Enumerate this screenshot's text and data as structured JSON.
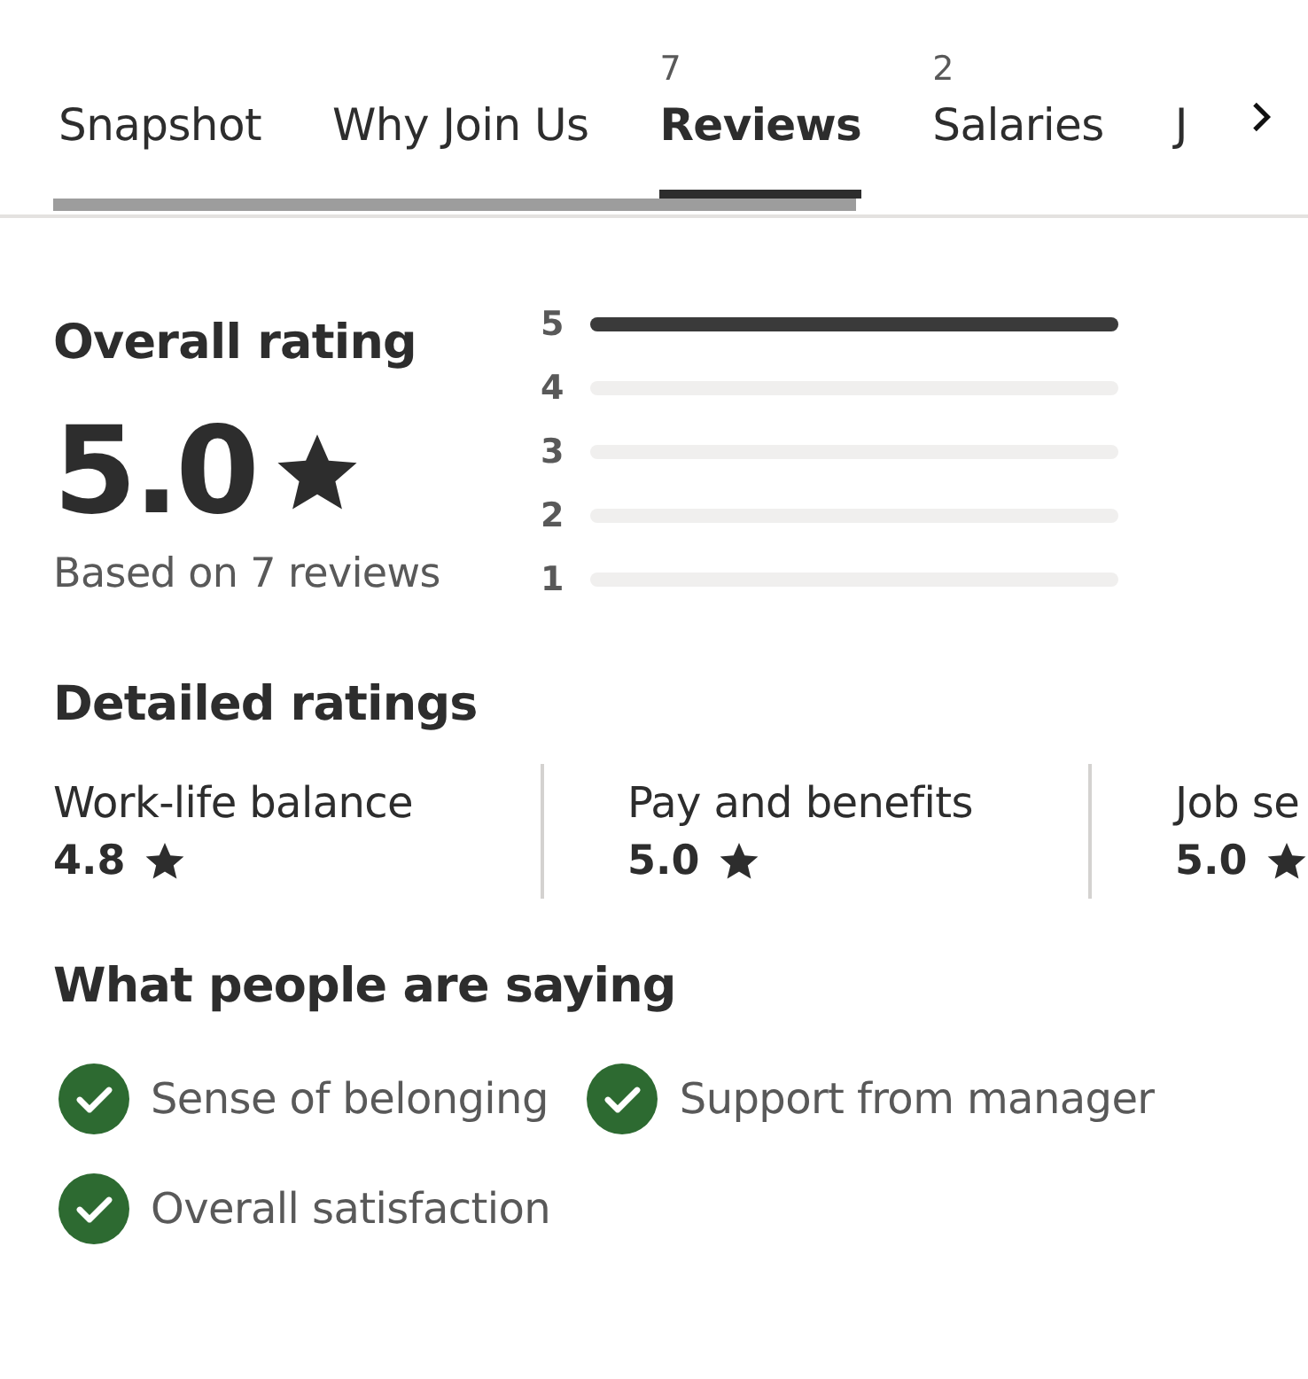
{
  "tabs": [
    {
      "label": "Snapshot",
      "selected": false
    },
    {
      "label": "Why Join Us",
      "selected": false
    },
    {
      "label": "Reviews",
      "count": "7",
      "selected": true
    },
    {
      "label": "Salaries",
      "count": "2",
      "selected": false
    },
    {
      "label": "J",
      "selected": false
    }
  ],
  "overall": {
    "title": "Overall rating",
    "score": "5.0",
    "basis": "Based on 7 reviews",
    "distribution": [
      {
        "label": "5",
        "level": 1
      },
      {
        "label": "4",
        "level": 0
      },
      {
        "label": "3",
        "level": 0
      },
      {
        "label": "2",
        "level": 0
      },
      {
        "label": "1",
        "level": 0
      }
    ]
  },
  "detailed": {
    "title": "Detailed ratings",
    "items": [
      {
        "label": "Work-life balance",
        "score": "4.8"
      },
      {
        "label": "Pay and benefits",
        "score": "5.0"
      },
      {
        "label": "Job se",
        "score": "5.0"
      }
    ]
  },
  "saying": {
    "title": "What people are saying",
    "items": [
      "Sense of belonging",
      "Support from manager",
      "Overall satisfaction"
    ]
  }
}
